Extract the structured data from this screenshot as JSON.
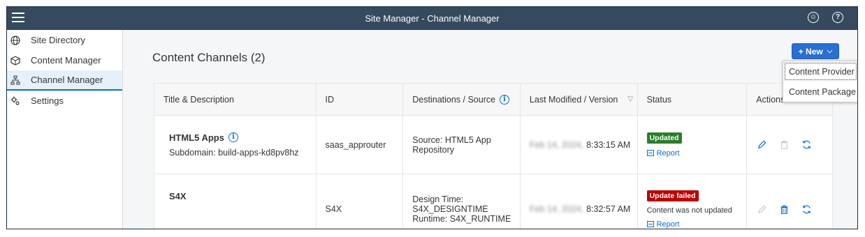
{
  "shell": {
    "title": "Site Manager - Channel Manager",
    "icons": {
      "menu": "hamburger-icon",
      "user": "user-icon",
      "help": "help-icon"
    }
  },
  "sidebar": {
    "items": [
      {
        "label": "Site Directory",
        "icon": "globe-icon"
      },
      {
        "label": "Content Manager",
        "icon": "cube-icon"
      },
      {
        "label": "Channel Manager",
        "icon": "network-icon",
        "active": true
      },
      {
        "label": "Settings",
        "icon": "gear-icon"
      }
    ]
  },
  "main": {
    "title": "Content Channels (2)",
    "new_button": "+ New",
    "dropdown": [
      "Content Provider",
      "Content Package"
    ]
  },
  "table": {
    "headers": [
      "Title & Description",
      "ID",
      "Destinations / Source",
      "Last Modified / Version",
      "Status",
      "Actions"
    ],
    "rows": [
      {
        "title": "HTML5 Apps",
        "subtitle": "Subdomain: build-apps-kd8pv8hz",
        "id": "saas_approuter",
        "dest_line1": "Source: HTML5 App",
        "dest_line2": "Repository",
        "dest_line3": "",
        "date_blurred": "Feb 14, 2024,",
        "time": "8:33:15 AM",
        "status": "Updated",
        "status_text": "",
        "report": "Report"
      },
      {
        "title": "S4X",
        "subtitle": "",
        "id": "S4X",
        "dest_line1": "Design Time:",
        "dest_line2": "S4X_DESIGNTIME",
        "dest_line3": "Runtime: S4X_RUNTIME",
        "date_blurred": "Feb 14, 2024,",
        "time": "8:32:57 AM",
        "status": "Update failed",
        "status_text": "Content was not updated",
        "report": "Report"
      }
    ]
  },
  "colors": {
    "shell": "#354a5f",
    "accent": "#0a6ed1",
    "success": "#2b7d2b",
    "error": "#bb0000"
  }
}
